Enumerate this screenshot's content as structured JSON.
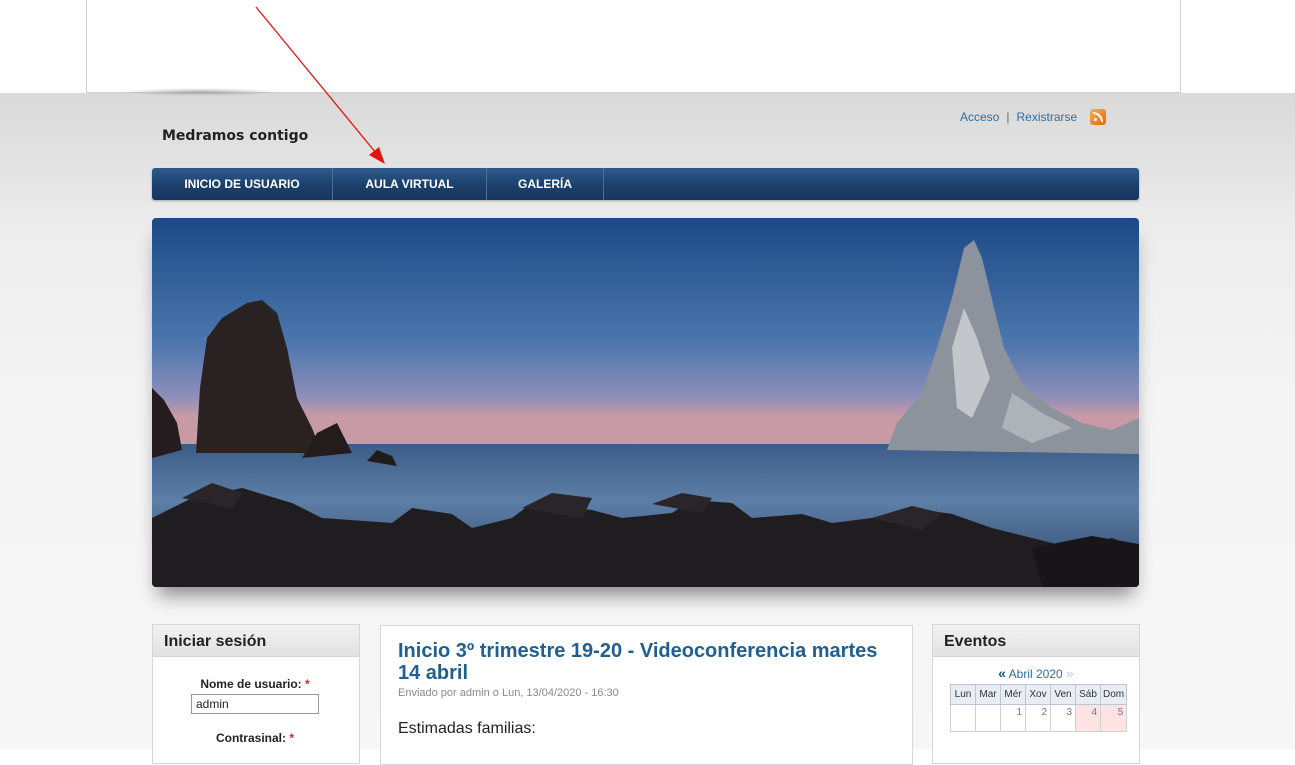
{
  "site": {
    "name": "Medramos contigo"
  },
  "user_links": {
    "login": "Acceso",
    "separator": "|",
    "register": "Rexistrarse",
    "rss_icon": "rss-feed-icon"
  },
  "nav": {
    "items": [
      {
        "label": "INICIO DE USUARIO"
      },
      {
        "label": "AULA VIRTUAL"
      },
      {
        "label": "GALERÍA"
      }
    ]
  },
  "annotation": {
    "arrow_color": "#e3140f"
  },
  "login_block": {
    "title": "Iniciar sesión",
    "username_label": "Nome de usuario:",
    "username_value": "admin",
    "password_label": "Contrasinal:",
    "required_marker": "*"
  },
  "article": {
    "title": "Inicio 3º trimestre 19-20 - Videoconferencia martes 14 abril",
    "submitted": "Enviado por admin o Lun, 13/04/2020 - 16:30",
    "body": "Estimadas familias:"
  },
  "events_block": {
    "title": "Eventos",
    "prev": "«",
    "month": "Abril 2020",
    "next": "»",
    "weekdays": [
      "Lun",
      "Mar",
      "Mér",
      "Xov",
      "Ven",
      "Sáb",
      "Dom"
    ],
    "first_week": [
      "",
      "",
      "1",
      "2",
      "3",
      "4",
      "5"
    ]
  },
  "colors": {
    "nav": "#1b3f6b",
    "link": "#2b6ea6",
    "title": "#205f8f",
    "weekend": "#fde3e3"
  }
}
